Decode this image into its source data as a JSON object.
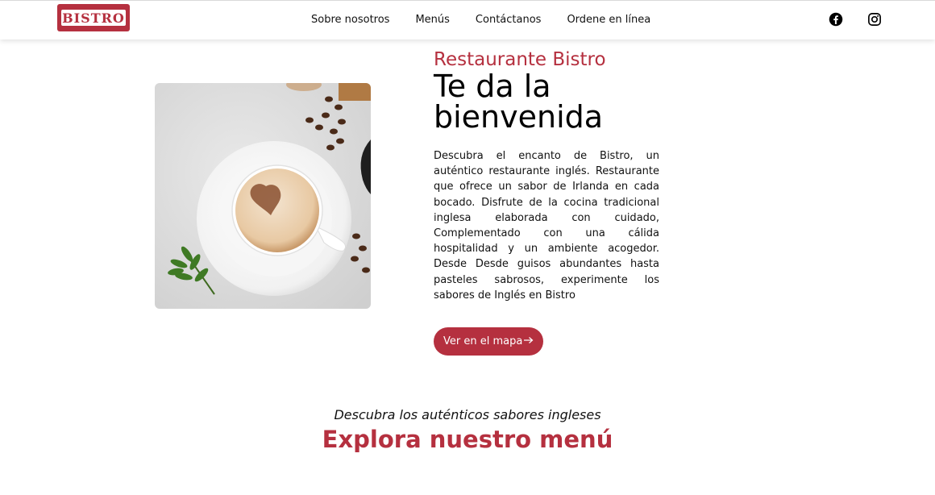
{
  "header": {
    "logo_text": "BISTRO",
    "nav": [
      {
        "label": "Sobre nosotros"
      },
      {
        "label": "Menús"
      },
      {
        "label": "Contáctanos"
      },
      {
        "label": "Ordene en línea"
      }
    ],
    "social_icons": [
      "facebook-icon",
      "instagram-icon"
    ]
  },
  "hero": {
    "subtitle": "Restaurante Bistro",
    "title": "Te da la bienvenida",
    "description": "Descubra el encanto de Bistro, un auténtico restaurante inglés. Restaurante que ofrece un sabor de Irlanda en cada bocado. Disfrute de la cocina tradicional inglesa elaborada con cuidado, Complementado con una cálida hospitalidad y un ambiente acogedor. Desde Desde guisos abundantes hasta pasteles sabrosos, experimente los sabores de Inglés en Bistro",
    "map_button": "Ver en el mapa",
    "map_button_icon": "arrow-right-icon"
  },
  "menu_section": {
    "tagline": "Descubra los auténticos sabores ingleses",
    "title": "Explora nuestro menú"
  },
  "colors": {
    "brand": "#b5303f",
    "text": "#111111",
    "background": "#ffffff"
  }
}
